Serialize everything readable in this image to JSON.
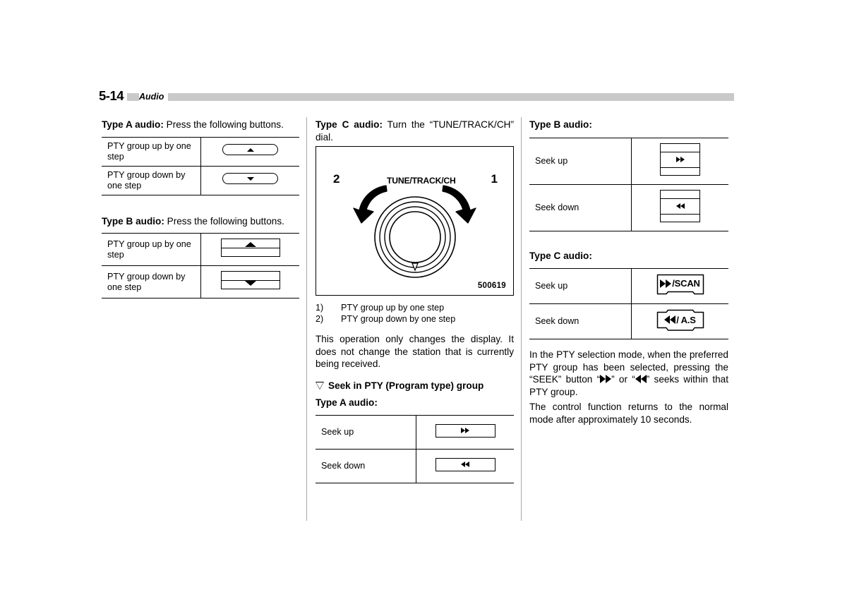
{
  "header": {
    "page_number": "5-14",
    "section": "Audio"
  },
  "left_column": {
    "type_a_intro_bold": "Type A audio:",
    "type_a_intro_rest": " Press the following buttons.",
    "type_a_table": {
      "rows": [
        {
          "label": "PTY group up by one step",
          "button": "pill-up-arrow"
        },
        {
          "label": "PTY group down by one step",
          "button": "pill-down-arrow"
        }
      ]
    },
    "type_b_intro_bold": "Type B audio:",
    "type_b_intro_rest": " Press the following buttons.",
    "type_b_table": {
      "rows": [
        {
          "label": "PTY group up by one step",
          "button": "rect-up-arrow"
        },
        {
          "label": "PTY group down by one step",
          "button": "rect-down-arrow"
        }
      ]
    }
  },
  "middle_column": {
    "type_c_intro_bold": "Type C audio:",
    "type_c_intro_rest": " Turn the “TUNE/TRACK/CH” dial.",
    "figure": {
      "id": "500619",
      "dial_label": "TUNE/TRACK/CH",
      "callout_1": "1",
      "callout_2": "2"
    },
    "legend": [
      {
        "num": "1)",
        "text": "PTY group up by one step"
      },
      {
        "num": "2)",
        "text": "PTY group down by one step"
      }
    ],
    "note": "This operation only changes the display. It does not change the station that is currently being received.",
    "seek_heading": "Seek in PTY (Program type) group",
    "seek_type_a_heading": "Type A audio:",
    "seek_type_a_table": {
      "rows": [
        {
          "label": "Seek up",
          "button": "plain-fast-forward"
        },
        {
          "label": "Seek down",
          "button": "plain-rewind"
        }
      ]
    }
  },
  "right_column": {
    "type_b_heading": "Type B audio:",
    "type_b_table": {
      "rows": [
        {
          "label": "Seek up",
          "button": "band-fast-forward"
        },
        {
          "label": "Seek down",
          "button": "band-rewind"
        }
      ]
    },
    "type_c_heading": "Type C audio:",
    "type_c_table": {
      "rows": [
        {
          "label": "Seek up",
          "button": "notch-scan",
          "button_text": "/SCAN"
        },
        {
          "label": "Seek down",
          "button": "notch-as",
          "button_text": "/ A.S"
        }
      ]
    },
    "note_1_part1": "In the PTY selection mode, when the preferred PTY group has been selected, pressing the “SEEK” button “",
    "note_1_part2": "” or “",
    "note_1_part3": "” seeks within that PTY group.",
    "note_2": "The control function returns to the normal mode after approximately 10 seconds."
  },
  "colors": {
    "header_bar": "#c9c9c9",
    "divider": "#a8a8a8",
    "text": "#000000",
    "background": "#ffffff"
  }
}
